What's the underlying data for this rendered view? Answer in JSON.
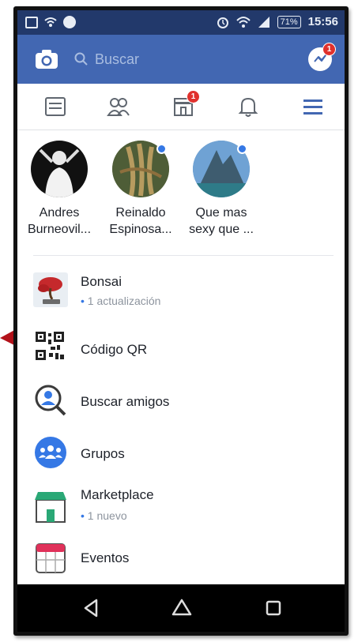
{
  "status_bar": {
    "battery": "71%",
    "time": "15:56"
  },
  "app_bar": {
    "search_placeholder": "Buscar",
    "messenger_badge": "1"
  },
  "tabs": {
    "marketplace_badge": "1"
  },
  "stories": [
    {
      "name_line1": "Andres",
      "name_line2": "Burneovil..."
    },
    {
      "name_line1": "Reinaldo",
      "name_line2": "Espinosa..."
    },
    {
      "name_line1": "Que mas",
      "name_line2": "sexy que ..."
    }
  ],
  "menu": [
    {
      "label": "Bonsai",
      "sub": "1 actualización"
    },
    {
      "label": "Código QR"
    },
    {
      "label": "Buscar amigos"
    },
    {
      "label": "Grupos"
    },
    {
      "label": "Marketplace",
      "sub": "1 nuevo"
    },
    {
      "label": "Eventos"
    }
  ],
  "colors": {
    "brand": "#4267b2",
    "status_bar": "#22396b",
    "badge": "#e0312d",
    "accent": "#3578e5"
  }
}
